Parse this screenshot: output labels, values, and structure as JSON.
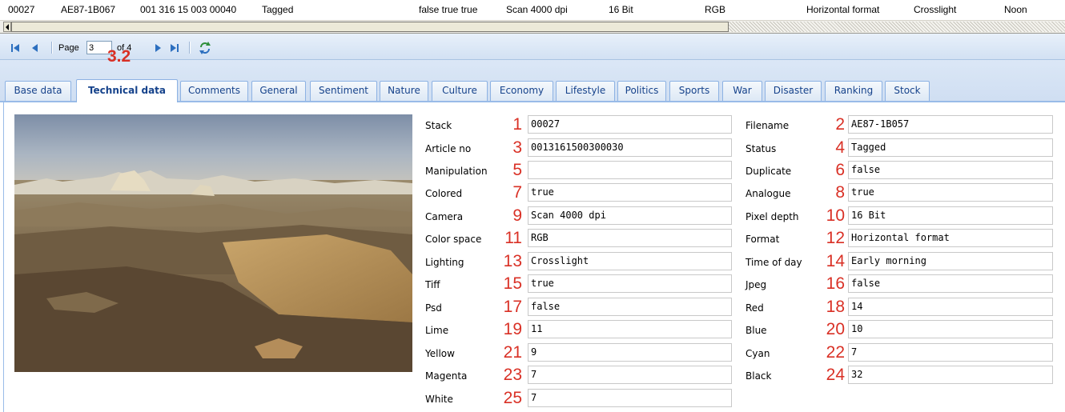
{
  "record_row": {
    "cells": [
      "00027",
      "AE87-1B067",
      "001 316 15 003 00040",
      "Tagged",
      "false true  true",
      "Scan 4000 dpi",
      "16 Bit",
      "RGB",
      "Horizontal format",
      "Crosslight",
      "Noon"
    ]
  },
  "toolbar": {
    "page_label": "Page",
    "page_value": "3",
    "of_label": "of 4",
    "icons": [
      "first-page-icon",
      "prev-page-icon",
      "next-page-icon",
      "last-page-icon",
      "refresh-icon"
    ]
  },
  "annotation": {
    "section_number": "3.2"
  },
  "tabs": [
    {
      "label": "Base data"
    },
    {
      "label": "Technical data",
      "active": true
    },
    {
      "label": "Comments"
    },
    {
      "label": "General"
    },
    {
      "label": "Sentiment"
    },
    {
      "label": "Nature"
    },
    {
      "label": "Culture"
    },
    {
      "label": "Economy"
    },
    {
      "label": "Lifestyle"
    },
    {
      "label": "Politics"
    },
    {
      "label": "Sports"
    },
    {
      "label": "War"
    },
    {
      "label": "Disaster"
    },
    {
      "label": "Ranking"
    },
    {
      "label": "Stock"
    }
  ],
  "fields": [
    {
      "num": "1",
      "label": "Stack",
      "value": "00027"
    },
    {
      "num": "2",
      "label": "Filename",
      "value": "AE87-1B057"
    },
    {
      "num": "3",
      "label": "Article no",
      "value": "0013161500300030"
    },
    {
      "num": "4",
      "label": "Status",
      "value": "Tagged"
    },
    {
      "num": "5",
      "label": "Manipulation",
      "value": ""
    },
    {
      "num": "6",
      "label": "Duplicate",
      "value": "false"
    },
    {
      "num": "7",
      "label": "Colored",
      "value": "true"
    },
    {
      "num": "8",
      "label": "Analogue",
      "value": "true"
    },
    {
      "num": "9",
      "label": "Camera",
      "value": "Scan 4000 dpi"
    },
    {
      "num": "10",
      "label": "Pixel depth",
      "value": "16 Bit"
    },
    {
      "num": "11",
      "label": "Color space",
      "value": "RGB"
    },
    {
      "num": "12",
      "label": "Format",
      "value": "Horizontal format"
    },
    {
      "num": "13",
      "label": "Lighting",
      "value": "Crosslight"
    },
    {
      "num": "14",
      "label": "Time of day",
      "value": "Early morning"
    },
    {
      "num": "15",
      "label": "Tiff",
      "value": "true"
    },
    {
      "num": "16",
      "label": "Jpeg",
      "value": "false"
    },
    {
      "num": "17",
      "label": "Psd",
      "value": "false"
    },
    {
      "num": "18",
      "label": "Red",
      "value": "14"
    },
    {
      "num": "19",
      "label": "Lime",
      "value": "11"
    },
    {
      "num": "20",
      "label": "Blue",
      "value": "10"
    },
    {
      "num": "21",
      "label": "Yellow",
      "value": "9"
    },
    {
      "num": "22",
      "label": "Cyan",
      "value": "7"
    },
    {
      "num": "23",
      "label": "Magenta",
      "value": "7"
    },
    {
      "num": "24",
      "label": "Black",
      "value": "32"
    },
    {
      "num": "25",
      "label": "White",
      "value": "7"
    }
  ],
  "colors": {
    "annotation_red": "#d93025",
    "tab_text": "#15428b",
    "tab_border": "#8db2e3",
    "toolbar_bg": "#d2e1f3",
    "icon_blue": "#2c6fbf"
  }
}
